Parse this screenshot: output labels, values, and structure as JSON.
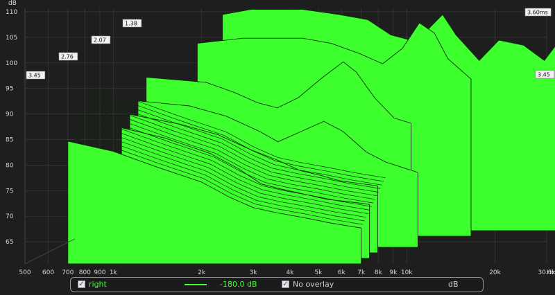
{
  "chart_data": {
    "type": "area",
    "title": "",
    "y_unit_label": "dB",
    "ylim": [
      60,
      110
    ],
    "y_ticks": [
      65,
      70,
      75,
      80,
      85,
      90,
      95,
      100,
      105,
      110
    ],
    "x_unit_label": "Hz",
    "xlim": [
      500,
      30000
    ],
    "x_scale": "log",
    "x_ticks": [
      {
        "value": 500,
        "label": "500"
      },
      {
        "value": 600,
        "label": "600"
      },
      {
        "value": 700,
        "label": "700"
      },
      {
        "value": 800,
        "label": "800"
      },
      {
        "value": 900,
        "label": "900"
      },
      {
        "value": 1000,
        "label": "1k"
      },
      {
        "value": 2000,
        "label": "2k"
      },
      {
        "value": 3000,
        "label": "3k"
      },
      {
        "value": 4000,
        "label": "4k"
      },
      {
        "value": 5000,
        "label": "5k"
      },
      {
        "value": 6000,
        "label": "6k"
      },
      {
        "value": 7000,
        "label": "7k"
      },
      {
        "value": 8000,
        "label": "8k"
      },
      {
        "value": 9000,
        "label": "9k"
      },
      {
        "value": 10000,
        "label": "10k"
      },
      {
        "value": 20000,
        "label": "20k"
      },
      {
        "value": 30000,
        "label": "30.0k"
      }
    ],
    "time_axis_labels": [
      "3.45",
      "2.76",
      "2.07",
      "1.38",
      "3.60ms",
      "3.45"
    ],
    "colors": {
      "fill": "#3dff2e",
      "stroke": "#0c2e08",
      "grid": "#3a3a3a",
      "background": "#1e1e1e"
    },
    "series": [
      {
        "values": [
          [
            700,
            84
          ],
          [
            1000,
            82
          ],
          [
            1400,
            79
          ],
          [
            2000,
            76
          ],
          [
            2500,
            73
          ],
          [
            3000,
            71
          ],
          [
            3600,
            70
          ],
          [
            4500,
            69
          ],
          [
            5500,
            68
          ],
          [
            7000,
            67
          ]
        ]
      },
      {
        "values": [
          [
            1000,
            86
          ],
          [
            1400,
            84
          ],
          [
            2000,
            81
          ],
          [
            2500,
            78
          ],
          [
            3000,
            75
          ],
          [
            3500,
            74
          ],
          [
            4200,
            73
          ],
          [
            5000,
            72
          ],
          [
            6000,
            71.5
          ],
          [
            7000,
            71
          ]
        ]
      },
      {
        "values": [
          [
            1000,
            88
          ],
          [
            1500,
            86
          ],
          [
            2000,
            84
          ],
          [
            2600,
            81
          ],
          [
            3200,
            79
          ],
          [
            3800,
            77
          ],
          [
            4500,
            76
          ],
          [
            5200,
            75
          ],
          [
            6000,
            74.5
          ],
          [
            7000,
            74
          ]
        ]
      },
      {
        "values": [
          [
            1000,
            90
          ],
          [
            1500,
            89
          ],
          [
            2000,
            87
          ],
          [
            2600,
            84
          ],
          [
            3000,
            82
          ],
          [
            3600,
            84
          ],
          [
            4300,
            86
          ],
          [
            5000,
            84
          ],
          [
            6000,
            80
          ],
          [
            7000,
            78
          ],
          [
            9000,
            76
          ]
        ]
      },
      {
        "values": [
          [
            1000,
            94
          ],
          [
            1600,
            93
          ],
          [
            2000,
            91
          ],
          [
            2400,
            89
          ],
          [
            2800,
            88
          ],
          [
            3300,
            90
          ],
          [
            4000,
            94
          ],
          [
            4700,
            97
          ],
          [
            5200,
            95
          ],
          [
            6000,
            90
          ],
          [
            7000,
            86
          ],
          [
            8000,
            85
          ]
        ]
      },
      {
        "values": [
          [
            1400,
            100
          ],
          [
            2000,
            101
          ],
          [
            2500,
            101
          ],
          [
            3200,
            101
          ],
          [
            4000,
            100
          ],
          [
            5000,
            98
          ],
          [
            6000,
            96
          ],
          [
            7000,
            99
          ],
          [
            8000,
            104
          ],
          [
            9000,
            102
          ],
          [
            10000,
            97
          ],
          [
            12000,
            93
          ]
        ]
      },
      {
        "values": [
          [
            1600,
            105
          ],
          [
            2000,
            106
          ],
          [
            3000,
            106
          ],
          [
            4000,
            105
          ],
          [
            5000,
            104
          ],
          [
            6000,
            101
          ],
          [
            7000,
            100
          ],
          [
            8000,
            102
          ],
          [
            9000,
            105
          ],
          [
            10000,
            101
          ],
          [
            12000,
            96
          ],
          [
            14000,
            100
          ],
          [
            17000,
            99
          ],
          [
            20000,
            96
          ],
          [
            24000,
            102
          ],
          [
            28000,
            104
          ]
        ]
      }
    ]
  },
  "legend": {
    "trace_checked": "✓",
    "trace_name": "right",
    "trace_value": "-180.0 dB",
    "overlay_checked": "✓",
    "overlay_label": "No overlay",
    "unit": "dB"
  }
}
